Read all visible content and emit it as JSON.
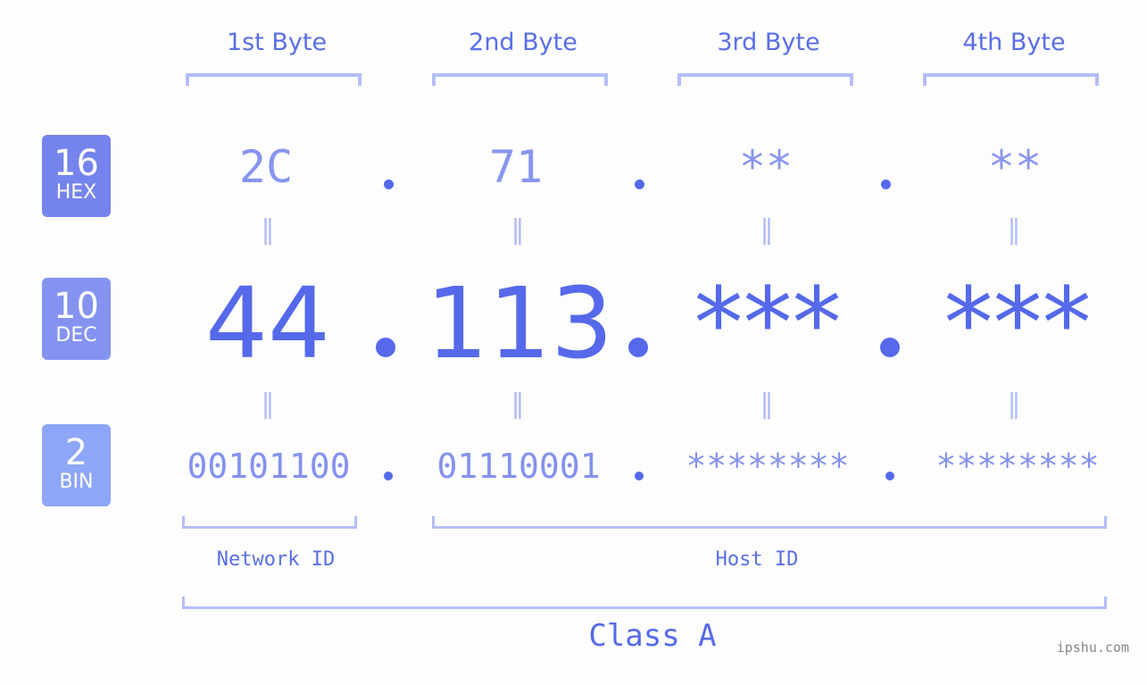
{
  "bytes": [
    {
      "title": "1st Byte",
      "hex": "2C",
      "dec": "44",
      "bin": "00101100"
    },
    {
      "title": "2nd Byte",
      "hex": "71",
      "dec": "113",
      "bin": "01110001"
    },
    {
      "title": "3rd Byte",
      "hex": "**",
      "dec": "***",
      "bin": "********"
    },
    {
      "title": "4th Byte",
      "hex": "**",
      "dec": "***",
      "bin": "********"
    }
  ],
  "badges": {
    "hex": {
      "num": "16",
      "label": "HEX",
      "color": "#7584ec"
    },
    "dec": {
      "num": "10",
      "label": "DEC",
      "color": "#8593f0"
    },
    "bin": {
      "num": "2",
      "label": "BIN",
      "color": "#8ea6f7"
    }
  },
  "equals_symbol": "=",
  "network_label": "Network ID",
  "host_label": "Host ID",
  "class_label": "Class A",
  "watermark": "ipshu.com"
}
